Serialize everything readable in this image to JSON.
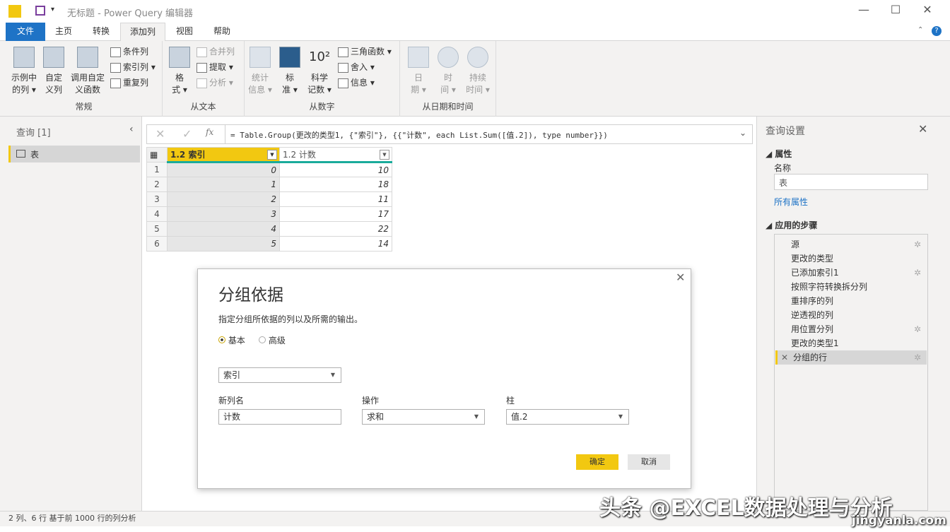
{
  "window": {
    "title": "无标题 - Power Query 编辑器",
    "controls": [
      "—",
      "☐",
      "✕"
    ]
  },
  "tabs": [
    "文件",
    "主页",
    "转换",
    "添加列",
    "视图",
    "帮助"
  ],
  "ribbon": {
    "groups": [
      {
        "label": "常规",
        "big": [
          [
            "示例中",
            "的列 ▾"
          ],
          [
            "自定",
            "义列"
          ],
          [
            "调用自定",
            "义函数"
          ]
        ],
        "small": [
          "条件列",
          "索引列 ▾",
          "重复列"
        ]
      },
      {
        "label": "从文本",
        "big": [
          [
            "格",
            "式 ▾"
          ]
        ],
        "small": [
          "合并列",
          "提取 ▾",
          "分析 ▾"
        ]
      },
      {
        "label": "从数字",
        "big": [
          [
            "统计",
            "信息 ▾"
          ],
          [
            "标",
            "准 ▾"
          ],
          [
            "科学",
            "记数 ▾"
          ]
        ],
        "small": [
          "三角函数 ▾",
          "舍入 ▾",
          "信息 ▾"
        ]
      },
      {
        "label": "从日期和时间",
        "big": [
          [
            "日",
            "期 ▾"
          ],
          [
            "时",
            "间 ▾"
          ],
          [
            "持续",
            "时间 ▾"
          ]
        ]
      }
    ]
  },
  "left": {
    "title": "查询 [1]",
    "items": [
      "表"
    ]
  },
  "formula": {
    "text": "= Table.Group(更改的类型1, {\"索引\"}, {{\"计数\", each List.Sum([值.2]), type number}})"
  },
  "table": {
    "columns": [
      {
        "type": "1.2",
        "name": "索引"
      },
      {
        "type": "1.2",
        "name": "计数"
      }
    ],
    "rows": [
      [
        "1",
        "0",
        "10"
      ],
      [
        "2",
        "1",
        "18"
      ],
      [
        "3",
        "2",
        "11"
      ],
      [
        "4",
        "3",
        "17"
      ],
      [
        "5",
        "4",
        "22"
      ],
      [
        "6",
        "5",
        "14"
      ]
    ]
  },
  "dialog": {
    "title": "分组依据",
    "desc": "指定分组所依据的列以及所需的输出。",
    "radio_basic": "基本",
    "radio_advanced": "高级",
    "group_by": "索引",
    "new_col_label": "新列名",
    "new_col_value": "计数",
    "op_label": "操作",
    "op_value": "求和",
    "col_label": "柱",
    "col_value": "值.2",
    "ok": "确定",
    "cancel": "取消"
  },
  "right": {
    "title": "查询设置",
    "props": "属性",
    "name_label": "名称",
    "name_value": "表",
    "all_props": "所有属性",
    "steps_title": "应用的步骤",
    "steps": [
      {
        "n": "源",
        "g": true
      },
      {
        "n": "更改的类型",
        "g": false
      },
      {
        "n": "已添加索引1",
        "g": true
      },
      {
        "n": "按照字符转换拆分列",
        "g": false
      },
      {
        "n": "重排序的列",
        "g": false
      },
      {
        "n": "逆透视的列",
        "g": false
      },
      {
        "n": "用位置分列",
        "g": true
      },
      {
        "n": "更改的类型1",
        "g": false
      },
      {
        "n": "分组的行",
        "g": true
      }
    ]
  },
  "status": "2 列、6 行    基于前 1000 行的列分析",
  "watermark": {
    "main": "头条 @EXCEL数据处理与分析",
    "site": "jingyanla.com"
  },
  "colors": {
    "accent": "#f2c811",
    "file_tab": "#1e73c6",
    "link": "#1e73c6"
  }
}
